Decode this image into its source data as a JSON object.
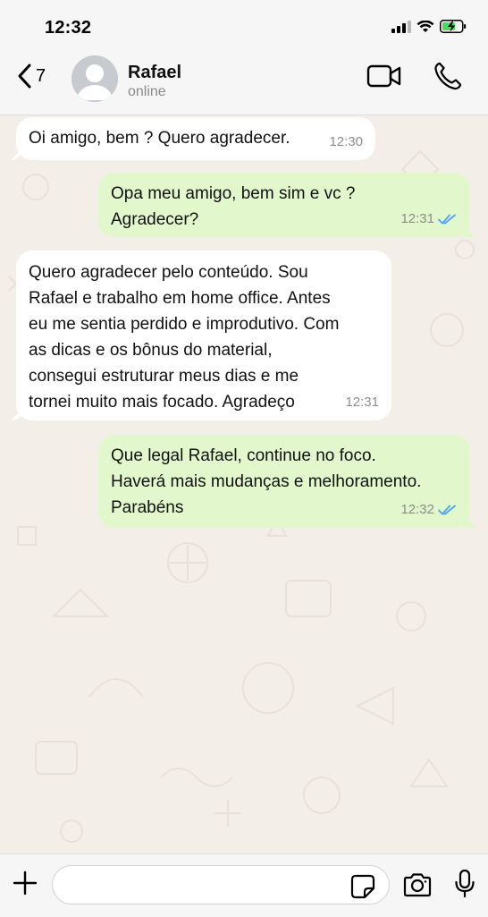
{
  "status_bar": {
    "time": "12:32"
  },
  "header": {
    "back_count": "7",
    "contact_name": "Rafael",
    "contact_status": "online"
  },
  "messages": [
    {
      "direction": "in",
      "text": "Oi amigo, bem ? Quero agradecer.",
      "time": "12:30"
    },
    {
      "direction": "out",
      "text": "Opa meu amigo, bem sim e vc ?\nAgradecer?",
      "time": "12:31",
      "read": true
    },
    {
      "direction": "in",
      "text": "Quero agradecer pelo conteúdo. Sou\nRafael e trabalho em home office. Antes\neu me sentia perdido e improdutivo. Com\nas dicas e os bônus do material,\nconsegui estruturar meus dias e me\ntornei muito mais focado. Agradeço",
      "time": "12:31"
    },
    {
      "direction": "out",
      "text": "Que legal Rafael, continue no foco.\nHaverá mais mudanças e melhoramento.\nParabéns",
      "time": "12:32",
      "read": true
    }
  ],
  "colors": {
    "incoming_bubble": "#ffffff",
    "outgoing_bubble": "#e2f7cb",
    "read_ticks": "#4fa3f7",
    "chat_background": "#f3efe8",
    "battery_fill": "#4cd964"
  },
  "composer": {
    "message_value": ""
  },
  "icons": {
    "back": "chevron-left-icon",
    "video": "video-camera-icon",
    "call": "phone-icon",
    "plus": "plus-icon",
    "sticker": "sticker-icon",
    "camera": "camera-icon",
    "mic": "microphone-icon"
  }
}
